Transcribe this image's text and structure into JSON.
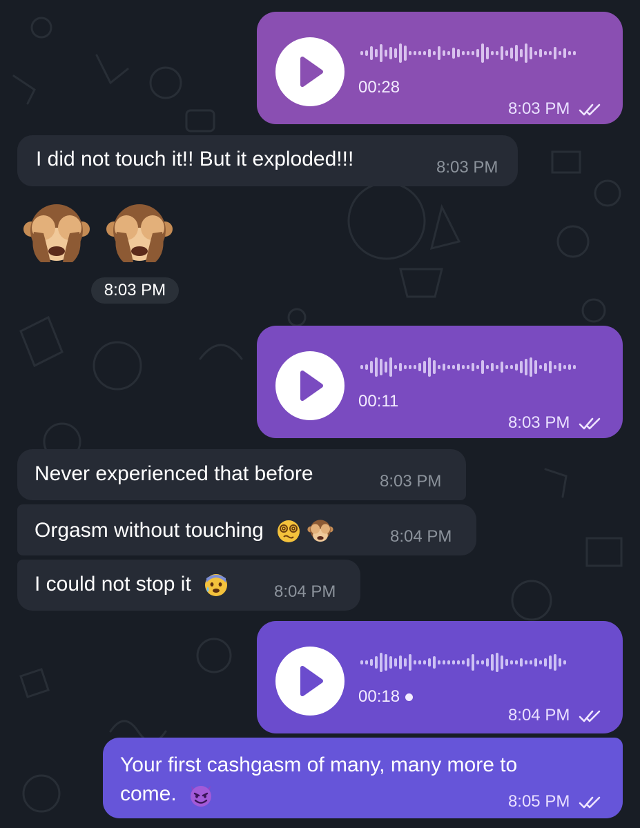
{
  "messages": [
    {
      "kind": "voice",
      "dir": "out",
      "duration": "00:28",
      "time": "8:03 PM",
      "color": "#8a4fb2",
      "played": true
    },
    {
      "kind": "text",
      "dir": "in",
      "text": "I did not touch it!! But it exploded!!!",
      "time": "8:03 PM"
    },
    {
      "kind": "emoji",
      "dir": "in",
      "emoji": "see-no-evil-monkey x2",
      "time": "8:03 PM"
    },
    {
      "kind": "voice",
      "dir": "out",
      "duration": "00:11",
      "time": "8:03 PM",
      "color": "#7a4bc0"
    },
    {
      "kind": "text",
      "dir": "in",
      "text": "Never experienced that before",
      "time": "8:03 PM"
    },
    {
      "kind": "text",
      "dir": "in",
      "text": "Orgasm without touching",
      "emoji": [
        "dizzy-face",
        "see-no-evil-monkey"
      ],
      "time": "8:04 PM"
    },
    {
      "kind": "text",
      "dir": "in",
      "text": "I could not stop it",
      "emoji": [
        "anxious-face-with-sweat"
      ],
      "time": "8:04 PM"
    },
    {
      "kind": "voice",
      "dir": "out",
      "duration": "00:18",
      "time": "8:04 PM",
      "color": "#6b4ccd",
      "unplayed_dot": true
    },
    {
      "kind": "text",
      "dir": "out",
      "text_line1": "Your first cashgasm of many, many more to",
      "text_line2": "come.",
      "emoji": [
        "smiling-face-with-horns"
      ],
      "time": "8:05 PM",
      "color": "#6655d9"
    }
  ],
  "m0": {
    "duration": "00:28",
    "time": "8:03 PM"
  },
  "m1": {
    "text": "I did not touch it!! But it exploded!!!",
    "time": "8:03 PM"
  },
  "m2": {
    "time": "8:03 PM"
  },
  "m3": {
    "duration": "00:11",
    "time": "8:03 PM"
  },
  "m4": {
    "text": "Never experienced that before",
    "time": "8:03 PM"
  },
  "m5": {
    "text": "Orgasm without touching",
    "time": "8:04 PM"
  },
  "m6": {
    "text": "I could not stop it",
    "time": "8:04 PM"
  },
  "m7": {
    "duration": "00:18",
    "time": "8:04 PM"
  },
  "m8": {
    "line1": "Your first cashgasm of many, many more to",
    "line2": "come.",
    "time": "8:05 PM"
  },
  "icons": {
    "play": "play-icon",
    "read": "double-check-icon"
  },
  "colors": {
    "background": "#181d25",
    "incoming": "#262b35",
    "voice1": "#8a4fb2",
    "voice2": "#7a4bc0",
    "voice3": "#6b4ccd",
    "outgoing_text": "#6655d9"
  }
}
